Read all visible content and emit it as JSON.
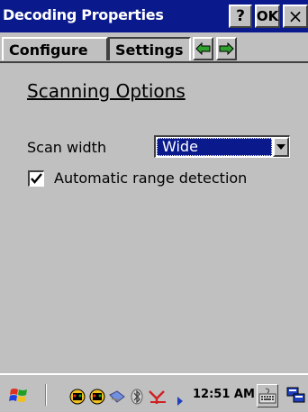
{
  "window": {
    "title": "Decoding Properties",
    "help_label": "?",
    "ok_label": "OK",
    "close_label": "×"
  },
  "tabs": [
    {
      "label": "Configure"
    },
    {
      "label": "Settings"
    }
  ],
  "content": {
    "section_title": "Scanning Options",
    "scan_width": {
      "label": "Scan width",
      "selected": "Wide"
    },
    "range_detection": {
      "label": "Automatic range detection",
      "checked": true
    }
  },
  "taskbar": {
    "time": "12:51 AM"
  },
  "colors": {
    "titlebar": "#0a1a8c",
    "face": "#c0c0c0",
    "arrow_green": "#2fa02f"
  }
}
